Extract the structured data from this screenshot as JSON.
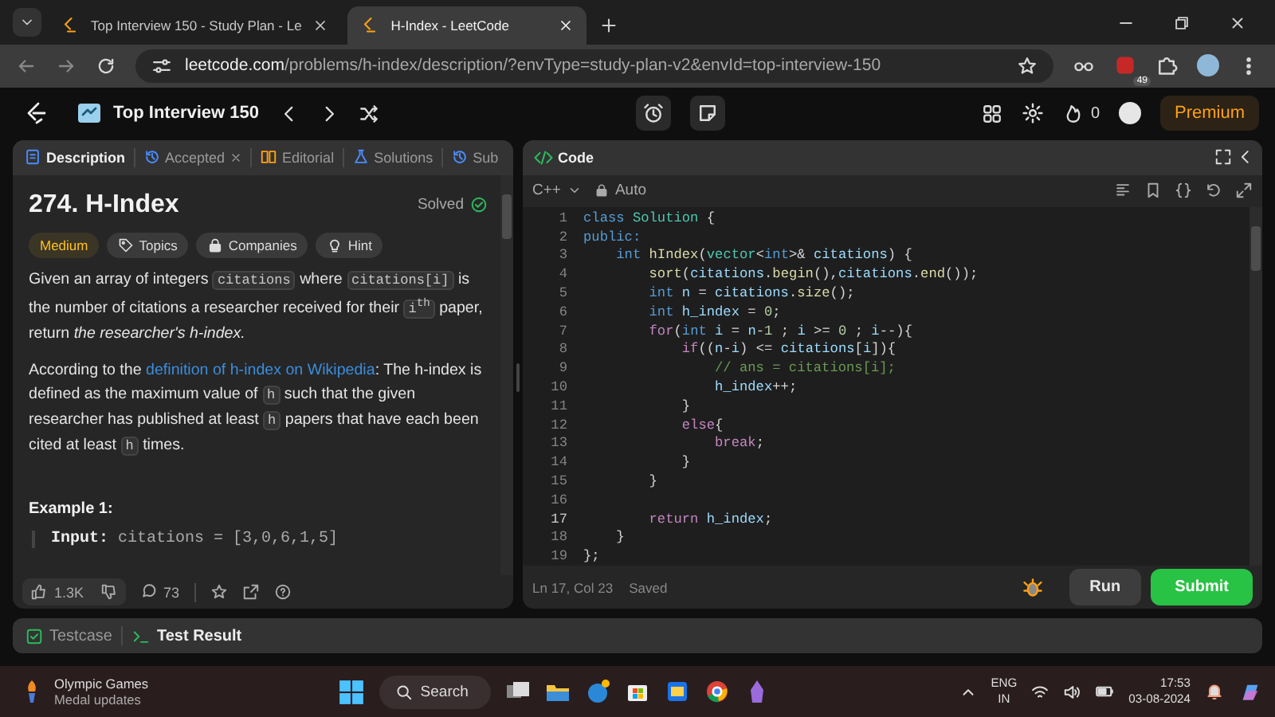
{
  "browser": {
    "tabs": [
      {
        "title": "Top Interview 150 - Study Plan - Le",
        "selected": false
      },
      {
        "title": "H-Index - LeetCode",
        "selected": true
      }
    ],
    "url_host": "leetcode.com",
    "url_path": "/problems/h-index/description/?envType=study-plan-v2&envId=top-interview-150",
    "extension_badge": "49"
  },
  "nav": {
    "study_plan": "Top Interview 150",
    "streak": "0",
    "premium": "Premium"
  },
  "description_panel": {
    "tabs": [
      {
        "label": "Description",
        "selected": true,
        "closable": false
      },
      {
        "label": "Accepted",
        "selected": false,
        "closable": true
      },
      {
        "label": "Editorial",
        "selected": false,
        "closable": false
      },
      {
        "label": "Solutions",
        "selected": false,
        "closable": false
      },
      {
        "label": "Sub",
        "selected": false,
        "closable": false
      }
    ],
    "title": "274. H-Index",
    "status": "Solved",
    "tags": [
      {
        "kind": "difficulty",
        "label": "Medium"
      },
      {
        "kind": "topics",
        "label": "Topics"
      },
      {
        "kind": "companies",
        "label": "Companies"
      },
      {
        "kind": "hint",
        "label": "Hint"
      }
    ],
    "paragraphs": [
      [
        {
          "kind": "text",
          "text": "Given an array of integers "
        },
        {
          "kind": "code",
          "text": "citations"
        },
        {
          "kind": "text",
          "text": " where "
        },
        {
          "kind": "code",
          "text": "citations[i]"
        },
        {
          "kind": "text",
          "text": " is the number of citations a researcher received for their "
        },
        {
          "kind": "code",
          "text": "i$^{th}$"
        },
        {
          "kind": "text",
          "text": " paper, return "
        },
        {
          "kind": "italic",
          "text": "the researcher's h-index."
        }
      ],
      [
        {
          "kind": "text",
          "text": "According to the "
        },
        {
          "kind": "link",
          "text": "definition of h-index on Wikipedia"
        },
        {
          "kind": "text",
          "text": ": The h-index is defined as the maximum value of "
        },
        {
          "kind": "code",
          "text": "h"
        },
        {
          "kind": "text",
          "text": " such that the given researcher has published at least "
        },
        {
          "kind": "code",
          "text": "h"
        },
        {
          "kind": "text",
          "text": " papers that have each been cited at least "
        },
        {
          "kind": "code",
          "text": "h"
        },
        {
          "kind": "text",
          "text": " times."
        }
      ]
    ],
    "example_heading": "Example 1:",
    "example_input_label": "Input:",
    "example_input": "citations = [3,0,6,1,5]",
    "likes": "1.3K",
    "comments": "73"
  },
  "editor": {
    "title": "Code",
    "language": "C++",
    "mode": "Auto",
    "lines": [
      {
        "number": "1",
        "current": false,
        "tokens": [
          {
            "kind": "keyword",
            "text": "class"
          },
          {
            "kind": "type",
            "text": " Solution"
          },
          {
            "kind": "plain",
            "text": " {"
          }
        ]
      },
      {
        "number": "2",
        "current": false,
        "tokens": [
          {
            "kind": "keyword",
            "text": "public:"
          }
        ]
      },
      {
        "number": "3",
        "current": false,
        "tokens": [
          {
            "kind": "keyword",
            "text": "    int"
          },
          {
            "kind": "function",
            "text": " hIndex"
          },
          {
            "kind": "plain",
            "text": "("
          },
          {
            "kind": "type",
            "text": "vector"
          },
          {
            "kind": "plain",
            "text": "<"
          },
          {
            "kind": "keyword",
            "text": "int"
          },
          {
            "kind": "plain",
            "text": ">& "
          },
          {
            "kind": "variable",
            "text": "citations"
          },
          {
            "kind": "plain",
            "text": ") {"
          }
        ]
      },
      {
        "number": "4",
        "current": false,
        "tokens": [
          {
            "kind": "function",
            "text": "        sort"
          },
          {
            "kind": "plain",
            "text": "("
          },
          {
            "kind": "variable",
            "text": "citations"
          },
          {
            "kind": "plain",
            "text": "."
          },
          {
            "kind": "function",
            "text": "begin"
          },
          {
            "kind": "plain",
            "text": "(),"
          },
          {
            "kind": "variable",
            "text": "citations"
          },
          {
            "kind": "plain",
            "text": "."
          },
          {
            "kind": "function",
            "text": "end"
          },
          {
            "kind": "plain",
            "text": "());"
          }
        ]
      },
      {
        "number": "5",
        "current": false,
        "tokens": [
          {
            "kind": "keyword",
            "text": "        int"
          },
          {
            "kind": "variable",
            "text": " n"
          },
          {
            "kind": "plain",
            "text": " = "
          },
          {
            "kind": "variable",
            "text": "citations"
          },
          {
            "kind": "plain",
            "text": "."
          },
          {
            "kind": "function",
            "text": "size"
          },
          {
            "kind": "plain",
            "text": "();"
          }
        ]
      },
      {
        "number": "6",
        "current": false,
        "tokens": [
          {
            "kind": "keyword",
            "text": "        int"
          },
          {
            "kind": "variable",
            "text": " h_index"
          },
          {
            "kind": "plain",
            "text": " = "
          },
          {
            "kind": "number",
            "text": "0"
          },
          {
            "kind": "plain",
            "text": ";"
          }
        ]
      },
      {
        "number": "7",
        "current": false,
        "tokens": [
          {
            "kind": "control",
            "text": "        for"
          },
          {
            "kind": "plain",
            "text": "("
          },
          {
            "kind": "keyword",
            "text": "int"
          },
          {
            "kind": "variable",
            "text": " i"
          },
          {
            "kind": "plain",
            "text": " = "
          },
          {
            "kind": "variable",
            "text": "n"
          },
          {
            "kind": "plain",
            "text": "-"
          },
          {
            "kind": "number",
            "text": "1"
          },
          {
            "kind": "plain",
            "text": " ; "
          },
          {
            "kind": "variable",
            "text": "i"
          },
          {
            "kind": "plain",
            "text": " >= "
          },
          {
            "kind": "number",
            "text": "0"
          },
          {
            "kind": "plain",
            "text": " ; "
          },
          {
            "kind": "variable",
            "text": "i"
          },
          {
            "kind": "plain",
            "text": "--){"
          }
        ]
      },
      {
        "number": "8",
        "current": false,
        "tokens": [
          {
            "kind": "control",
            "text": "            if"
          },
          {
            "kind": "plain",
            "text": "(("
          },
          {
            "kind": "variable",
            "text": "n"
          },
          {
            "kind": "plain",
            "text": "-"
          },
          {
            "kind": "variable",
            "text": "i"
          },
          {
            "kind": "plain",
            "text": ") <= "
          },
          {
            "kind": "variable",
            "text": "citations"
          },
          {
            "kind": "plain",
            "text": "["
          },
          {
            "kind": "variable",
            "text": "i"
          },
          {
            "kind": "plain",
            "text": "]){"
          }
        ]
      },
      {
        "number": "9",
        "current": false,
        "tokens": [
          {
            "kind": "comment",
            "text": "                // ans = citations[i];"
          }
        ]
      },
      {
        "number": "10",
        "current": false,
        "tokens": [
          {
            "kind": "variable",
            "text": "                h_index"
          },
          {
            "kind": "plain",
            "text": "++;"
          }
        ]
      },
      {
        "number": "11",
        "current": false,
        "tokens": [
          {
            "kind": "plain",
            "text": "            }"
          }
        ]
      },
      {
        "number": "12",
        "current": false,
        "tokens": [
          {
            "kind": "control",
            "text": "            else"
          },
          {
            "kind": "plain",
            "text": "{"
          }
        ]
      },
      {
        "number": "13",
        "current": false,
        "tokens": [
          {
            "kind": "control",
            "text": "                break"
          },
          {
            "kind": "plain",
            "text": ";"
          }
        ]
      },
      {
        "number": "14",
        "current": false,
        "tokens": [
          {
            "kind": "plain",
            "text": "            }"
          }
        ]
      },
      {
        "number": "15",
        "current": false,
        "tokens": [
          {
            "kind": "plain",
            "text": "        }"
          }
        ]
      },
      {
        "number": "16",
        "current": false
      },
      {
        "number": "17",
        "current": true,
        "tokens": [
          {
            "kind": "control",
            "text": "        return"
          },
          {
            "kind": "variable",
            "text": " h_index"
          },
          {
            "kind": "plain",
            "text": ";"
          }
        ]
      },
      {
        "number": "18",
        "current": false,
        "tokens": [
          {
            "kind": "plain",
            "text": "    }"
          }
        ]
      },
      {
        "number": "19",
        "current": false,
        "tokens": [
          {
            "kind": "plain",
            "text": "};"
          }
        ]
      }
    ],
    "cursor": "Ln 17, Col 23",
    "save_state": "Saved",
    "run": "Run",
    "submit": "Submit"
  },
  "console_tabs": [
    {
      "label": "Testcase",
      "selected": false
    },
    {
      "label": "Test Result",
      "selected": true
    }
  ],
  "taskbar": {
    "widget_title": "Olympic Games",
    "widget_subtitle": "Medal updates",
    "search": "Search",
    "language": "ENG",
    "region": "IN",
    "time": "17:53",
    "date": "03-08-2024"
  }
}
